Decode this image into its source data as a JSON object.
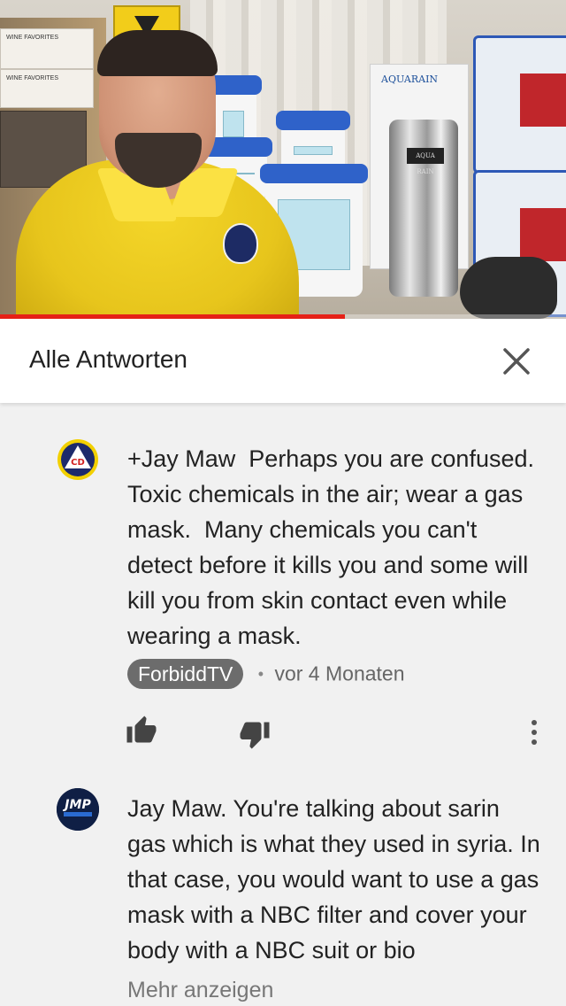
{
  "video": {
    "progress_fraction": 0.61,
    "props": {
      "box_label": "WINE FAVORITES",
      "brand": "AQUARAIN",
      "filter_tag": "AQUA RAIN"
    }
  },
  "panel": {
    "title": "Alle Antworten",
    "close_icon": "close-icon"
  },
  "comments": [
    {
      "avatar_text": "CD",
      "text": "+Jay Maw  Perhaps you are confused.  Toxic chemicals in the air; wear a gas mask.  Many chemicals you can't detect before it kills you and some will kill you from skin contact even while wearing a mask.",
      "author": "ForbiddTV",
      "separator": "•",
      "time": "vor 4 Monaten",
      "like_icon": "thumbs-up-icon",
      "dislike_icon": "thumbs-down-icon",
      "more_icon": "more-vert-icon"
    },
    {
      "avatar_text": "JMP",
      "text": "Jay Maw. You're talking about sarin gas which is what they used in syria. In that case, you would want to use a gas mask with a NBC filter and cover your body with a NBC suit or bio",
      "show_more": "Mehr anzeigen"
    }
  ],
  "colors": {
    "progress": "#e62117",
    "author_chip": "#6c6c6c",
    "background": "#f1f1f1"
  }
}
